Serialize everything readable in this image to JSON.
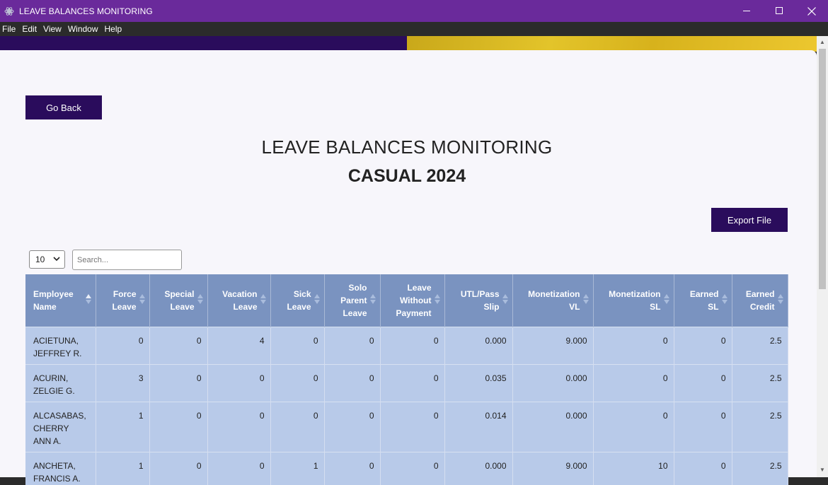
{
  "window": {
    "title": "LEAVE BALANCES MONITORING"
  },
  "menu": [
    "File",
    "Edit",
    "View",
    "Window",
    "Help"
  ],
  "buttons": {
    "go_back": "Go Back",
    "export": "Export File"
  },
  "page": {
    "title": "LEAVE BALANCES MONITORING",
    "subtitle": "CASUAL 2024"
  },
  "table_controls": {
    "page_length": "10",
    "search_placeholder": "Search..."
  },
  "columns": [
    [
      "Employee",
      "Name"
    ],
    [
      "Force",
      "Leave"
    ],
    [
      "Special",
      "Leave"
    ],
    [
      "Vacation",
      "Leave"
    ],
    [
      "Sick",
      "Leave"
    ],
    [
      "Solo",
      "Parent",
      "Leave"
    ],
    [
      "Leave",
      "Without",
      "Payment"
    ],
    [
      "UTL/Pass",
      "Slip"
    ],
    [
      "Monetization",
      "VL"
    ],
    [
      "Monetization",
      "SL"
    ],
    [
      "Earned",
      "SL"
    ],
    [
      "Earned",
      "Credit"
    ]
  ],
  "rows": [
    {
      "name": [
        "ACIETUNA,",
        "JEFFREY R."
      ],
      "values": [
        "0",
        "0",
        "4",
        "0",
        "0",
        "0",
        "0.000",
        "9.000",
        "0",
        "0",
        "2.5"
      ]
    },
    {
      "name": [
        "ACURIN,",
        "ZELGIE G."
      ],
      "values": [
        "3",
        "0",
        "0",
        "0",
        "0",
        "0",
        "0.035",
        "0.000",
        "0",
        "0",
        "2.5"
      ]
    },
    {
      "name": [
        "ALCASABAS,",
        "CHERRY",
        "ANN A."
      ],
      "values": [
        "1",
        "0",
        "0",
        "0",
        "0",
        "0",
        "0.014",
        "0.000",
        "0",
        "0",
        "2.5"
      ]
    },
    {
      "name": [
        "ANCHETA,",
        "FRANCIS A."
      ],
      "values": [
        "1",
        "0",
        "0",
        "1",
        "0",
        "0",
        "0.000",
        "9.000",
        "10",
        "0",
        "2.5"
      ]
    }
  ],
  "colors": {
    "titlebar": "#6a2a9b",
    "brand_dark": "#2a0c5c",
    "header_bg": "#7a93c0",
    "row_bg": "#b8cae9",
    "banner_gold": "#d7b21c"
  },
  "icons": {
    "app": "app-logo-icon",
    "minimize": "minimize-icon",
    "maximize": "maximize-icon",
    "close": "close-icon"
  }
}
